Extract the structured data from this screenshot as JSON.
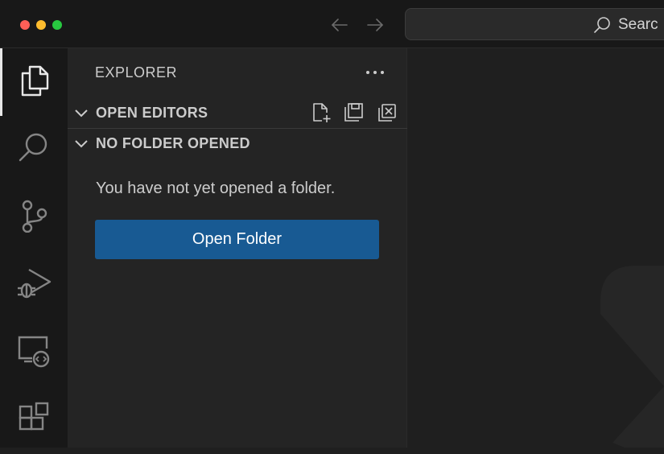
{
  "titlebar": {
    "search_text": "Searc",
    "icons": [
      "back-arrow-icon",
      "forward-arrow-icon",
      "search-icon"
    ]
  },
  "activity_bar": {
    "items": [
      {
        "name": "explorer",
        "icon": "files-icon",
        "active": true
      },
      {
        "name": "search",
        "icon": "search-icon"
      },
      {
        "name": "source-control",
        "icon": "source-control-icon"
      },
      {
        "name": "run-and-debug",
        "icon": "run-debug-icon"
      },
      {
        "name": "remote-explorer",
        "icon": "remote-explorer-icon"
      },
      {
        "name": "extensions",
        "icon": "extensions-icon"
      }
    ]
  },
  "sidebar": {
    "title": "EXPLORER",
    "sections": [
      {
        "label": "OPEN EDITORS",
        "actions": [
          "new-file-icon",
          "save-all-icon",
          "close-all-icon"
        ]
      },
      {
        "label": "NO FOLDER OPENED"
      }
    ],
    "empty_message": "You have not yet opened a folder.",
    "open_folder_label": "Open Folder"
  },
  "colors": {
    "button_bg": "#185a93",
    "titlebar_bg": "#181818",
    "sidebar_bg": "#242424",
    "editor_bg": "#1f1f1f"
  }
}
